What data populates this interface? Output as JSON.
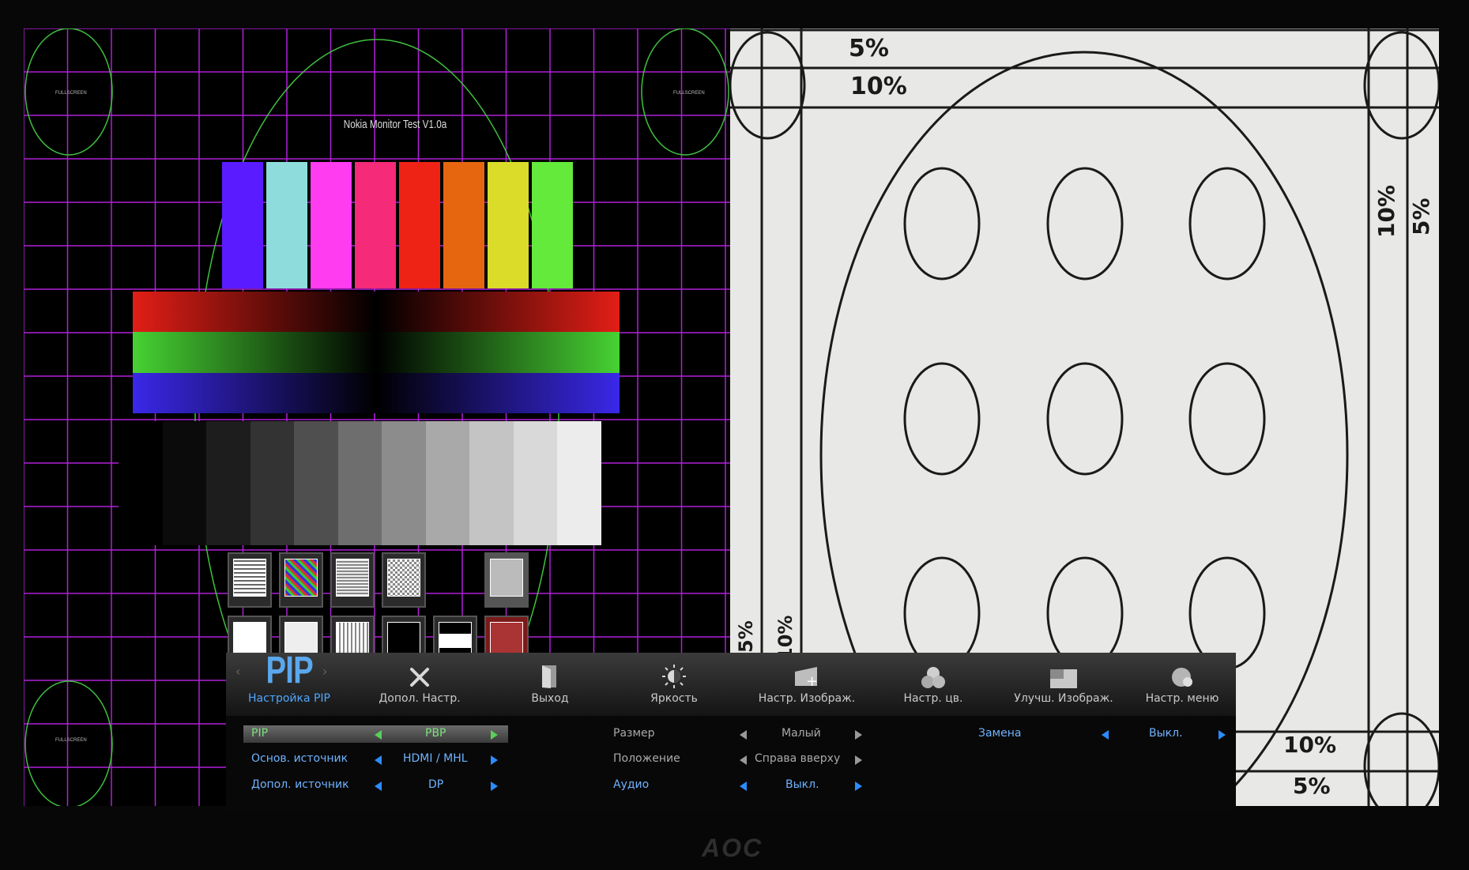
{
  "test_pattern": {
    "title": "Nokia Monitor Test V1.0a",
    "fullscreen_marks": [
      "FULLSCREEN",
      "FULLSCREEN",
      "FULLSCREEN"
    ],
    "color_bars": [
      "#5a1cff",
      "#8fdcdc",
      "#ff3cf0",
      "#f52a78",
      "#ee2316",
      "#e6660f",
      "#dbdb2a",
      "#63ea3a"
    ],
    "gradient_colors": [
      "#e21e16",
      "#47d233",
      "#3a28e8"
    ],
    "gray_levels": [
      "#000000",
      "#0b0b0b",
      "#1d1d1d",
      "#333333",
      "#4f4f4f",
      "#6e6e6e",
      "#8c8c8c",
      "#a9a9a9",
      "#c4c4c4",
      "#d9d9d9",
      "#ececec"
    ]
  },
  "pbp_pattern": {
    "labels": {
      "top_5": "5%",
      "top_10": "10%",
      "right_10": "10%",
      "right_5": "5%",
      "bottom_10": "10%",
      "bottom_5": "5%",
      "left_5": "5%",
      "left_10": "10%"
    }
  },
  "osd": {
    "tabs": [
      {
        "label": "Настройка PIP",
        "big": "PIP",
        "icon": "pip-icon"
      },
      {
        "label": "Допол. Настр.",
        "icon": "tools-icon"
      },
      {
        "label": "Выход",
        "icon": "exit-door-icon"
      },
      {
        "label": "Яркость",
        "icon": "brightness-icon"
      },
      {
        "label": "Настр. Изображ.",
        "icon": "image-setup-icon"
      },
      {
        "label": "Настр. цв.",
        "icon": "color-circles-icon"
      },
      {
        "label": "Улучш. Изображ.",
        "icon": "picture-boost-icon"
      },
      {
        "label": "Настр. меню",
        "icon": "menu-setup-icon"
      }
    ],
    "col1": [
      {
        "label": "PIP",
        "value": "PBP"
      },
      {
        "label": "Основ. источник",
        "value": "HDMI / MHL"
      },
      {
        "label": "Допол. источник",
        "value": "DP"
      }
    ],
    "col2": [
      {
        "label": "Размер",
        "value": "Малый"
      },
      {
        "label": "Положение",
        "value": "Справа вверху"
      },
      {
        "label": "Аудио",
        "value": "Выкл."
      }
    ],
    "col3": [
      {
        "label": "Замена",
        "value": "Выкл."
      }
    ]
  },
  "brand": "AOC",
  "colors": {
    "accent": "#4fa6ff",
    "grid": "#b021d8"
  }
}
